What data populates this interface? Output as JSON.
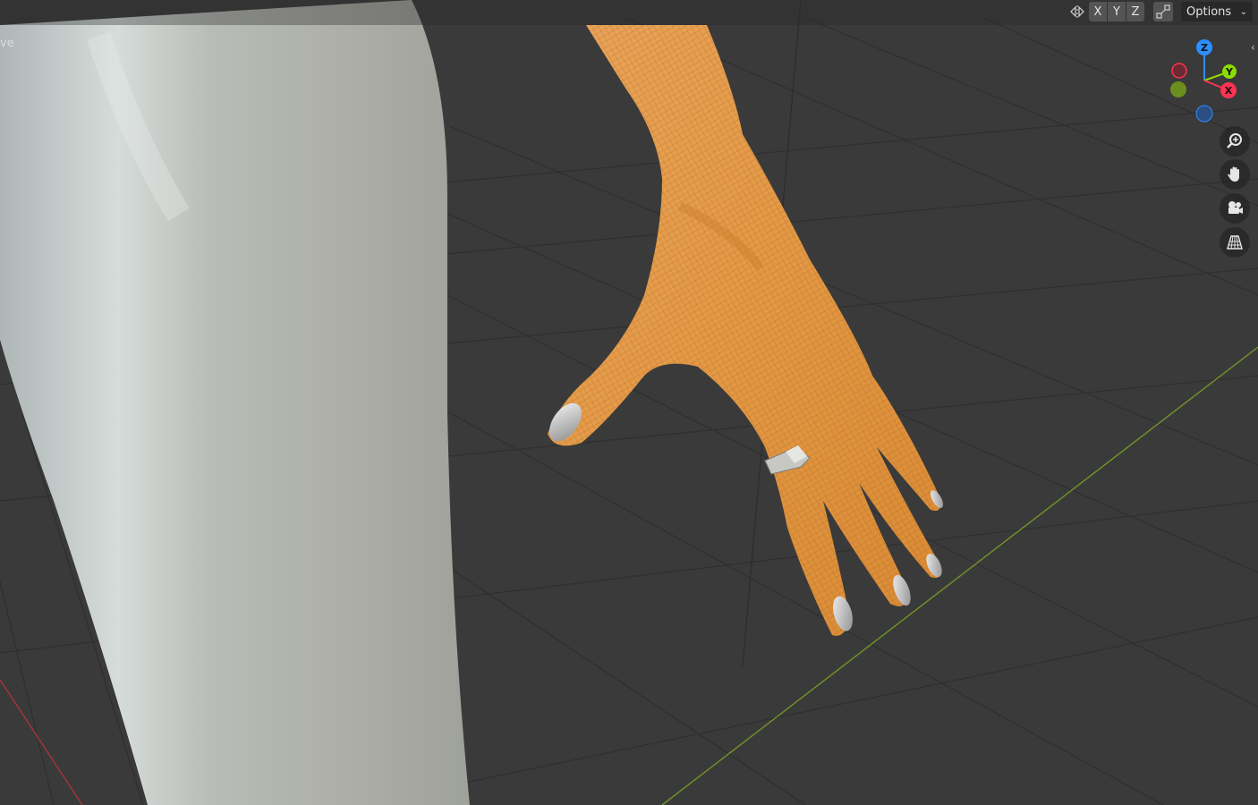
{
  "viewport": {
    "mode_label": "ve"
  },
  "toolbar": {
    "mirror_icon": "mirror-icon",
    "axis_x": "X",
    "axis_y": "Y",
    "axis_z": "Z",
    "snap_icon": "auto-normalize-icon",
    "options_label": "Options"
  },
  "gizmo": {
    "z_label": "Z",
    "y_label": "Y",
    "x_label": "X"
  },
  "navigation": {
    "zoom_icon": "zoom-icon",
    "pan_icon": "hand-icon",
    "camera_icon": "camera-icon",
    "perspective_icon": "grid-perspective-icon"
  },
  "colors": {
    "background": "#3a3a3a",
    "skin_wire": "#e8973a",
    "x_axis": "#ff3352",
    "y_axis": "#8bdc00",
    "z_axis": "#2c8fff"
  }
}
